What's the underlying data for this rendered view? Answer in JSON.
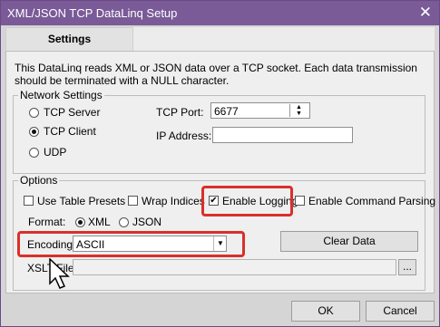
{
  "window": {
    "title": "XML/JSON TCP DataLinq Setup",
    "close_glyph": "✕"
  },
  "tabs": [
    {
      "label": "Settings"
    }
  ],
  "description": "This DataLinq reads XML or JSON data over a TCP socket.  Each data transmission should be terminated with a NULL character.",
  "network": {
    "legend": "Network Settings",
    "modes": [
      {
        "label": "TCP Server",
        "selected": false
      },
      {
        "label": "TCP Client",
        "selected": true
      },
      {
        "label": "UDP",
        "selected": false
      }
    ],
    "port_label": "TCP Port:",
    "port_value": "6677",
    "ip_label": "IP Address:",
    "ip_value": ""
  },
  "options": {
    "legend": "Options",
    "checkboxes": [
      {
        "label": "Use Table Presets",
        "checked": false
      },
      {
        "label": "Wrap Indices",
        "checked": false
      },
      {
        "label": "Enable Logging",
        "checked": true
      },
      {
        "label": "Enable Command Parsing",
        "checked": false
      }
    ],
    "format_label": "Format:",
    "formats": [
      {
        "label": "XML",
        "selected": true
      },
      {
        "label": "JSON",
        "selected": false
      }
    ],
    "encoding_label": "Encoding:",
    "encoding_value": "ASCII",
    "clear_label": "Clear Data",
    "xslt_label": "XSLT File:",
    "xslt_value": "",
    "browse_label": "..."
  },
  "buttons": {
    "ok": "OK",
    "cancel": "Cancel"
  },
  "colors": {
    "title_bar": "#7a5a97",
    "highlight": "#d9302b"
  }
}
